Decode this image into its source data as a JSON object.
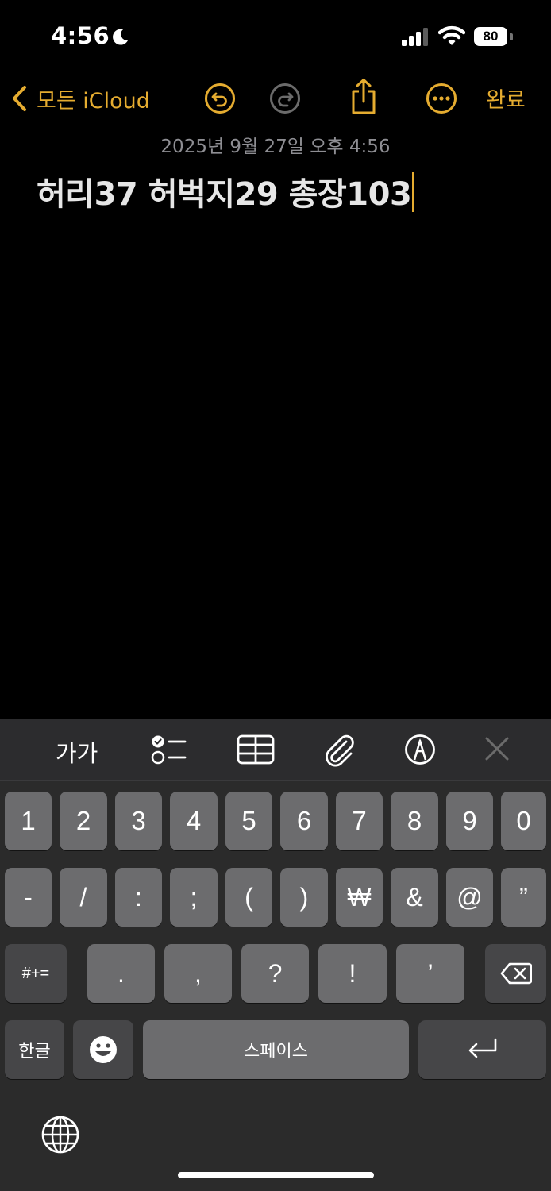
{
  "status_bar": {
    "time": "4:56",
    "focus_icon": "moon-icon",
    "signal_icon": "cellular-signal-icon",
    "wifi_icon": "wifi-icon",
    "battery_level": "80"
  },
  "nav": {
    "back_label": "모든 iCloud",
    "undo_icon": "undo-icon",
    "redo_icon": "redo-icon",
    "share_icon": "share-icon",
    "more_icon": "more-icon",
    "done_label": "완료",
    "accent_color": "#e5ac30"
  },
  "note": {
    "date": "2025년 9월 27일 오후 4:56",
    "body": "허리37 허벅지29 총장103"
  },
  "toolbar": {
    "format_label": "가가",
    "checklist_icon": "checklist-icon",
    "table_icon": "table-icon",
    "attach_icon": "paperclip-icon",
    "markup_icon": "markup-pen-icon",
    "close_icon": "close-icon"
  },
  "keyboard": {
    "row1": [
      "1",
      "2",
      "3",
      "4",
      "5",
      "6",
      "7",
      "8",
      "9",
      "0"
    ],
    "row2": [
      "-",
      "/",
      ":",
      ";",
      "(",
      ")",
      "₩",
      "&",
      "@",
      "”"
    ],
    "row3_mode": "#+=",
    "row3": [
      ".",
      ",",
      "?",
      "!",
      "’"
    ],
    "delete_icon": "backspace-icon",
    "lang_key": "한글",
    "emoji_icon": "emoji-icon",
    "space_label": "스페이스",
    "return_icon": "return-icon",
    "globe_icon": "globe-icon"
  }
}
